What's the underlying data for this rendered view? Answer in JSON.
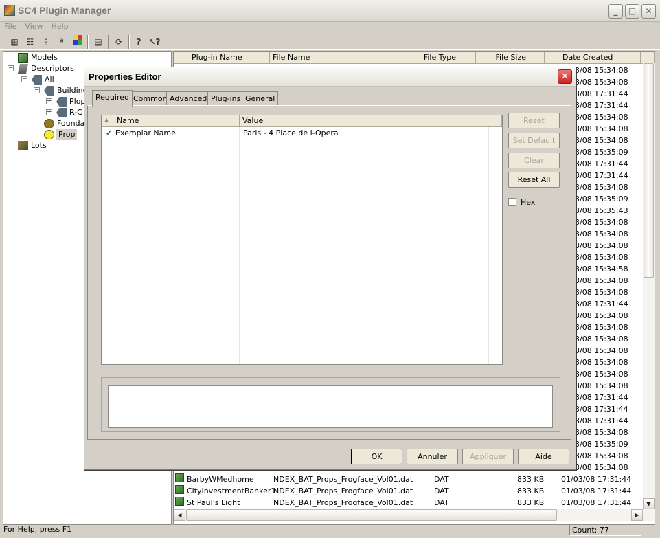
{
  "app": {
    "title": "SC4 Plugin Manager"
  },
  "menu": [
    "File",
    "View",
    "Help"
  ],
  "window_buttons": {
    "minimize": "_",
    "maximize": "□",
    "close": "✕"
  },
  "tree": [
    {
      "label": "Models",
      "level": 0
    },
    {
      "label": "Descriptors",
      "level": 0
    },
    {
      "label": "All",
      "level": 1
    },
    {
      "label": "Building",
      "level": 2
    },
    {
      "label": "Plop",
      "level": 3
    },
    {
      "label": "R-C",
      "level": 3
    },
    {
      "label": "Foundat",
      "level": 2
    },
    {
      "label": "Prop",
      "level": 2,
      "selected": true
    },
    {
      "label": "Lots",
      "level": 0
    }
  ],
  "list": {
    "columns": [
      "Plug-in Name",
      "File Name",
      "File Type",
      "File Size",
      "Date Created"
    ],
    "partial_dates": [
      "3/08 15:34:08",
      "3/08 15:34:08",
      "3/08 17:31:44",
      "3/08 17:31:44",
      "3/08 15:34:08",
      "3/08 15:34:08",
      "3/08 15:34:08",
      "3/08 15:35:09",
      "3/08 17:31:44",
      "3/08 17:31:44",
      "3/08 15:34:08",
      "3/08 15:35:09",
      "3/08 15:35:43",
      "3/08 15:34:08",
      "3/08 15:34:08",
      "3/08 15:34:08",
      "3/08 15:34:08",
      "3/08 15:34:58",
      "3/08 15:34:08",
      "3/08 15:34:08",
      "3/08 17:31:44",
      "3/08 15:34:08",
      "3/08 15:34:08",
      "3/08 15:34:08",
      "3/08 15:34:08",
      "3/08 15:34:08",
      "3/08 15:34:08",
      "3/08 15:34:08",
      "3/08 17:31:44",
      "3/08 17:31:44",
      "3/08 17:31:44",
      "3/08 15:34:08",
      "3/08 15:35:09",
      "3/08 15:34:08",
      "3/08 15:34:08"
    ],
    "rows": [
      {
        "name": "BarbyWMedhome",
        "file": "NDEX_BAT_Props_Frogface_Vol01.dat",
        "type": "DAT",
        "size": "833 KB",
        "date": "01/03/08 17:31:44"
      },
      {
        "name": "CityInvestmentBanker1",
        "file": "NDEX_BAT_Props_Frogface_Vol01.dat",
        "type": "DAT",
        "size": "833 KB",
        "date": "01/03/08 17:31:44"
      },
      {
        "name": "St Paul's Light",
        "file": "NDEX_BAT_Props_Frogface_Vol01.dat",
        "type": "DAT",
        "size": "833 KB",
        "date": "01/03/08 17:31:44"
      }
    ]
  },
  "status": {
    "help": "For Help, press F1",
    "count": "Count: 77"
  },
  "dialog": {
    "title": "Properties Editor",
    "tabs": [
      "Required",
      "Common",
      "Advanced",
      "Plug-ins",
      "General"
    ],
    "grid": {
      "columns": [
        "Name",
        "Value"
      ],
      "rows": [
        {
          "name": "Exemplar Name",
          "value": "Paris - 4 Place de l-Opera",
          "check": "✔"
        }
      ]
    },
    "side_buttons": {
      "reset": "Reset",
      "set_default": "Set Default",
      "clear": "Clear",
      "reset_all": "Reset All"
    },
    "hex_label": "Hex",
    "footer_buttons": {
      "ok": "OK",
      "cancel": "Annuler",
      "apply": "Appliquer",
      "help": "Aide"
    }
  }
}
